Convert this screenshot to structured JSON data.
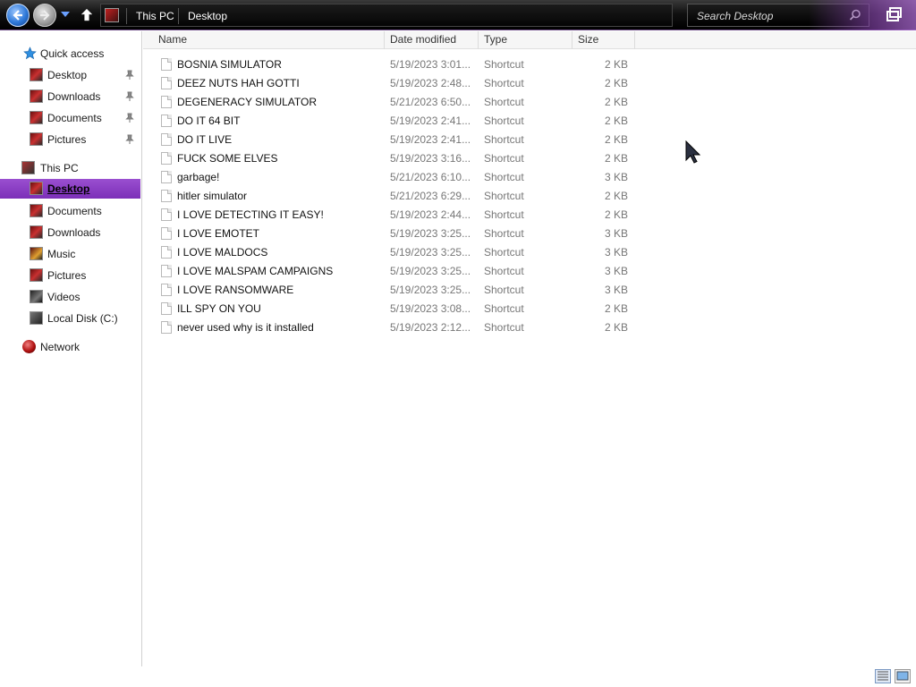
{
  "toolbar": {
    "breadcrumbs": [
      "This PC",
      "Desktop"
    ],
    "search_placeholder": "Search Desktop"
  },
  "sidebar": {
    "quick_access_label": "Quick access",
    "quick_access_items": [
      {
        "label": "Desktop",
        "icon": "folder-icon"
      },
      {
        "label": "Downloads",
        "icon": "folder-icon"
      },
      {
        "label": "Documents",
        "icon": "folder-icon"
      },
      {
        "label": "Pictures",
        "icon": "folder-icon"
      }
    ],
    "this_pc_label": "This PC",
    "this_pc_items": [
      {
        "label": "Desktop",
        "icon": "folder-icon",
        "selected": true
      },
      {
        "label": "Documents",
        "icon": "folder-icon"
      },
      {
        "label": "Downloads",
        "icon": "folder-icon"
      },
      {
        "label": "Music",
        "icon": "music-folder-icon"
      },
      {
        "label": "Pictures",
        "icon": "folder-icon"
      },
      {
        "label": "Videos",
        "icon": "video-folder-icon"
      },
      {
        "label": "Local Disk (C:)",
        "icon": "disk-icon"
      }
    ],
    "network_label": "Network"
  },
  "columns": {
    "name": "Name",
    "date": "Date modified",
    "type": "Type",
    "size": "Size"
  },
  "files": [
    {
      "name": "BOSNIA SIMULATOR",
      "date": "5/19/2023 3:01...",
      "type": "Shortcut",
      "size": "2 KB"
    },
    {
      "name": "DEEZ NUTS HAH GOTTI",
      "date": "5/19/2023 2:48...",
      "type": "Shortcut",
      "size": "2 KB"
    },
    {
      "name": "DEGENERACY SIMULATOR",
      "date": "5/21/2023 6:50...",
      "type": "Shortcut",
      "size": "2 KB"
    },
    {
      "name": "DO IT 64 BIT",
      "date": "5/19/2023 2:41...",
      "type": "Shortcut",
      "size": "2 KB"
    },
    {
      "name": "DO IT LIVE",
      "date": "5/19/2023 2:41...",
      "type": "Shortcut",
      "size": "2 KB"
    },
    {
      "name": "FUCK SOME ELVES",
      "date": "5/19/2023 3:16...",
      "type": "Shortcut",
      "size": "2 KB"
    },
    {
      "name": "garbage!",
      "date": "5/21/2023 6:10...",
      "type": "Shortcut",
      "size": "3 KB"
    },
    {
      "name": "hitler simulator",
      "date": "5/21/2023 6:29...",
      "type": "Shortcut",
      "size": "2 KB"
    },
    {
      "name": "I LOVE DETECTING IT EASY!",
      "date": "5/19/2023 2:44...",
      "type": "Shortcut",
      "size": "2 KB"
    },
    {
      "name": "I LOVE EMOTET",
      "date": "5/19/2023 3:25...",
      "type": "Shortcut",
      "size": "3 KB"
    },
    {
      "name": "I LOVE MALDOCS",
      "date": "5/19/2023 3:25...",
      "type": "Shortcut",
      "size": "3 KB"
    },
    {
      "name": "I LOVE MALSPAM CAMPAIGNS",
      "date": "5/19/2023 3:25...",
      "type": "Shortcut",
      "size": "3 KB"
    },
    {
      "name": "I LOVE RANSOMWARE",
      "date": "5/19/2023 3:25...",
      "type": "Shortcut",
      "size": "3 KB"
    },
    {
      "name": "ILL SPY ON YOU",
      "date": "5/19/2023 3:08...",
      "type": "Shortcut",
      "size": "2 KB"
    },
    {
      "name": "never used why is it installed",
      "date": "5/19/2023 2:12...",
      "type": "Shortcut",
      "size": "2 KB"
    }
  ],
  "colors": {
    "accent": "#8a3fc6",
    "topbar": "#000000"
  }
}
